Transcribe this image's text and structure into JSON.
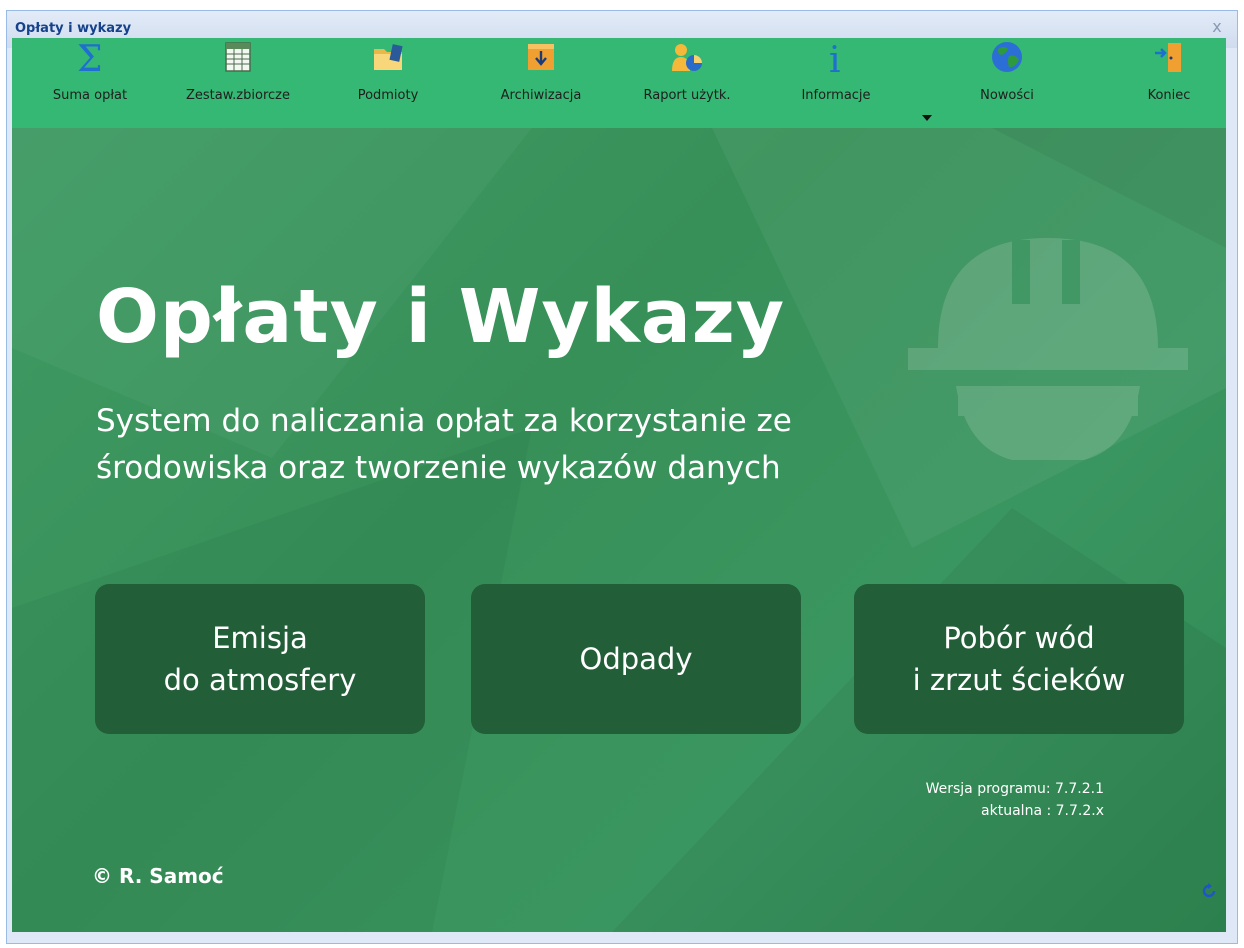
{
  "window": {
    "title": "Opłaty i wykazy",
    "close_glyph": "x"
  },
  "toolbar": {
    "items": [
      {
        "label": "Suma opłat",
        "icon": "sigma-icon"
      },
      {
        "label": "Zestaw.zbiorcze",
        "icon": "table-icon"
      },
      {
        "label": "Podmioty",
        "icon": "folder-icon"
      },
      {
        "label": "Archiwizacja",
        "icon": "archive-box-icon"
      },
      {
        "label": "Raport użytk.",
        "icon": "user-report-icon"
      },
      {
        "label": "Informacje",
        "icon": "info-icon"
      },
      {
        "label": "Nowości",
        "icon": "globe-icon"
      },
      {
        "label": "Koniec",
        "icon": "exit-door-icon"
      }
    ]
  },
  "hero": {
    "title": "Opłaty i Wykazy",
    "subtitle": "System do naliczania opłat za korzystanie ze środowiska oraz tworzenie wykazów danych"
  },
  "buttons": {
    "emisja": "Emisja\ndo atmosfery",
    "odpady": "Odpady",
    "pobor": "Pobór wód\ni zrzut ścieków"
  },
  "version": {
    "program": "Wersja programu: 7.7.2.1",
    "current": "aktualna : 7.7.2.x"
  },
  "footer": {
    "copyright": "© R. Samoć"
  },
  "colors": {
    "toolbar_bg": "#34b873",
    "main_bg": "#3a9660",
    "button_bg": "#225e37",
    "title_text": "#15428b"
  }
}
